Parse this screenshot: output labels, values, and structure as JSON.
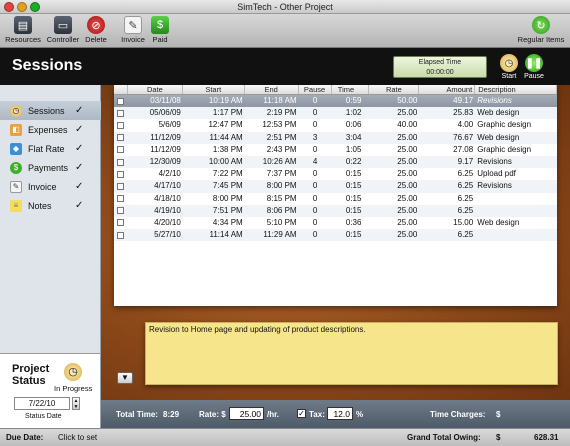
{
  "window": {
    "title": "SimTech - Other Project"
  },
  "toolbar": {
    "resources": "Resources",
    "controller": "Controller",
    "delete": "Delete",
    "invoice": "Invoice",
    "paid": "Paid",
    "regular_items": "Regular Items"
  },
  "header": {
    "title": "Sessions",
    "elapsed_label": "Elapsed Time",
    "elapsed_value": "00:00:00",
    "start": "Start",
    "pause": "Pause"
  },
  "sidebar": {
    "items": [
      {
        "label": "Sessions",
        "check": "✓"
      },
      {
        "label": "Expenses",
        "check": "✓"
      },
      {
        "label": "Flat Rate",
        "check": "✓"
      },
      {
        "label": "Payments",
        "check": "✓"
      },
      {
        "label": "Invoice",
        "check": "✓"
      },
      {
        "label": "Notes",
        "check": "✓"
      }
    ]
  },
  "status": {
    "title_line1": "Project",
    "title_line2": "Status",
    "state": "In Progress",
    "date": "7/22/10",
    "date_label": "Status Date"
  },
  "table": {
    "columns": [
      "Date",
      "Start",
      "End",
      "Pause",
      "Time",
      "Rate",
      "Amount",
      "Description"
    ],
    "rows": [
      {
        "date": "03/11/08",
        "start": "10:19 AM",
        "end": "11:18 AM",
        "pause": "0",
        "time": "0:59",
        "rate": "50.00",
        "amount": "49.17",
        "desc": "Revisions"
      },
      {
        "date": "05/06/09",
        "start": "1:17 PM",
        "end": "2:19 PM",
        "pause": "0",
        "time": "1:02",
        "rate": "25.00",
        "amount": "25.83",
        "desc": "Web design"
      },
      {
        "date": "5/6/09",
        "start": "12:47 PM",
        "end": "12:53 PM",
        "pause": "0",
        "time": "0:06",
        "rate": "40.00",
        "amount": "4.00",
        "desc": "Graphic design"
      },
      {
        "date": "11/12/09",
        "start": "11:44 AM",
        "end": "2:51 PM",
        "pause": "3",
        "time": "3:04",
        "rate": "25.00",
        "amount": "76.67",
        "desc": "Web design"
      },
      {
        "date": "11/12/09",
        "start": "1:38 PM",
        "end": "2:43 PM",
        "pause": "0",
        "time": "1:05",
        "rate": "25.00",
        "amount": "27.08",
        "desc": "Graphic design"
      },
      {
        "date": "12/30/09",
        "start": "10:00 AM",
        "end": "10:26 AM",
        "pause": "4",
        "time": "0:22",
        "rate": "25.00",
        "amount": "9.17",
        "desc": "Revisions"
      },
      {
        "date": "4/2/10",
        "start": "7:22 PM",
        "end": "7:37 PM",
        "pause": "0",
        "time": "0:15",
        "rate": "25.00",
        "amount": "6.25",
        "desc": "Upload pdf"
      },
      {
        "date": "4/17/10",
        "start": "7:45 PM",
        "end": "8:00 PM",
        "pause": "0",
        "time": "0:15",
        "rate": "25.00",
        "amount": "6.25",
        "desc": "Revisions"
      },
      {
        "date": "4/18/10",
        "start": "8:00 PM",
        "end": "8:15 PM",
        "pause": "0",
        "time": "0:15",
        "rate": "25.00",
        "amount": "6.25",
        "desc": ""
      },
      {
        "date": "4/19/10",
        "start": "7:51 PM",
        "end": "8:06 PM",
        "pause": "0",
        "time": "0:15",
        "rate": "25.00",
        "amount": "6.25",
        "desc": ""
      },
      {
        "date": "4/20/10",
        "start": "4:34 PM",
        "end": "5:10 PM",
        "pause": "0",
        "time": "0:36",
        "rate": "25.00",
        "amount": "15.00",
        "desc": "Web design"
      },
      {
        "date": "5/27/10",
        "start": "11:14 AM",
        "end": "11:29 AM",
        "pause": "0",
        "time": "0:15",
        "rate": "25.00",
        "amount": "6.25",
        "desc": ""
      }
    ]
  },
  "note": {
    "text": "Revision to Home page and updating of product descriptions."
  },
  "footer": {
    "total_time_label": "Total Time:",
    "total_time": "8:29",
    "rate_label": "Rate: $",
    "rate_value": "25.00",
    "rate_unit": "/hr.",
    "tax_label": "Tax:",
    "tax_value": "12.0",
    "tax_unit": "%",
    "time_charges_label": "Time Charges:",
    "time_charges_currency": "$"
  },
  "statusbar": {
    "due_label": "Due Date:",
    "due_value": "Click to set",
    "grand_label": "Grand Total Owing:",
    "grand_currency": "$",
    "grand_value": "628.31"
  },
  "colors": {
    "header_bg": "#111111",
    "note_bg": "#f6e58b",
    "wood": "#8e4a1a"
  }
}
